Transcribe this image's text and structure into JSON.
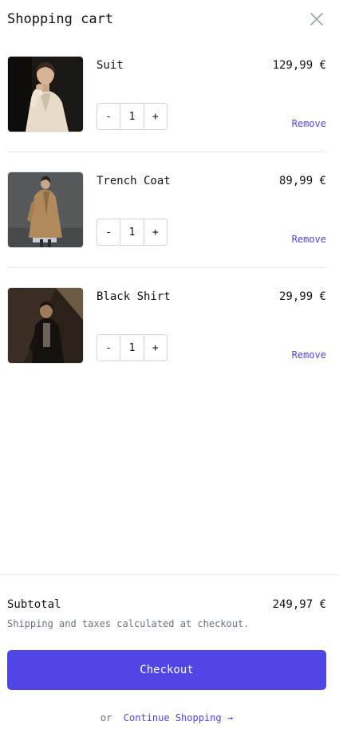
{
  "header": {
    "title": "Shopping cart"
  },
  "items": [
    {
      "name": "Suit",
      "price": "129,99 €",
      "quantity": "1",
      "decrement": "-",
      "increment": "+",
      "remove": "Remove"
    },
    {
      "name": "Trench Coat",
      "price": "89,99 €",
      "quantity": "1",
      "decrement": "-",
      "increment": "+",
      "remove": "Remove"
    },
    {
      "name": "Black Shirt",
      "price": "29,99 €",
      "quantity": "1",
      "decrement": "-",
      "increment": "+",
      "remove": "Remove"
    }
  ],
  "footer": {
    "subtotal_label": "Subtotal",
    "subtotal_value": "249,97 €",
    "shipping_note": "Shipping and taxes calculated at checkout.",
    "checkout_label": "Checkout",
    "or_text": "or",
    "continue_label": "Continue Shopping →"
  },
  "colors": {
    "accent": "#4f46e5",
    "divider": "#e5e7eb",
    "muted_text": "#6b7280"
  },
  "icons": {
    "close": "close-icon"
  }
}
